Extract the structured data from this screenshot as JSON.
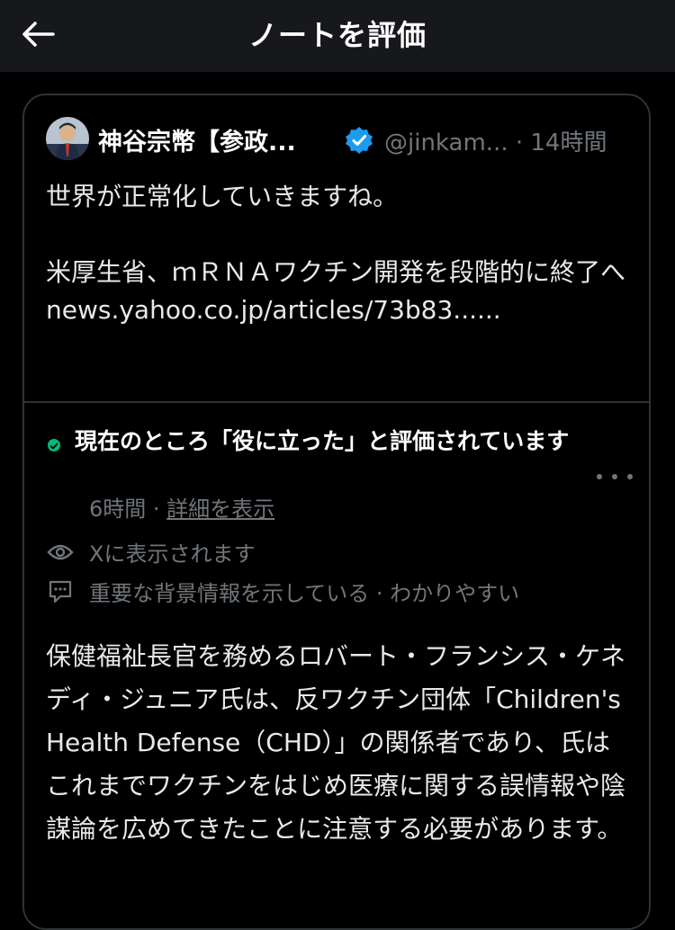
{
  "header": {
    "title": "ノートを評価"
  },
  "tweet": {
    "author_name": "神谷宗幣【参政...",
    "handle_time": "@jinkam... · 14時間",
    "text_line1": "世界が正常化していきますね。",
    "text_line2": "米厚生省、ｍＲＮＡワクチン開発を段階的に終了へ",
    "link": "news.yahoo.co.jp/articles/73b83......"
  },
  "note": {
    "status": "現在のところ「役に立った」と評価されています",
    "time": "6時間",
    "separator": " · ",
    "details_link": "詳細を表示",
    "visibility": "Xに表示されます",
    "reasons": "重要な背景情報を示している · わかりやすい",
    "body": "保健福祉長官を務めるロバート・フランシス・ケネディ・ジュニア氏は、反ワクチン団体「Children's Health Defense（CHD）」の関係者であり、氏はこれまでワクチンをはじめ医療に関する誤情報や陰謀論を広めてきたことに注意する必要があります。"
  },
  "colors": {
    "background": "#000000",
    "header_bg": "#16181c",
    "verified": "#1d9bf0",
    "status_dot": "#00ba7c",
    "muted": "#71767b"
  }
}
